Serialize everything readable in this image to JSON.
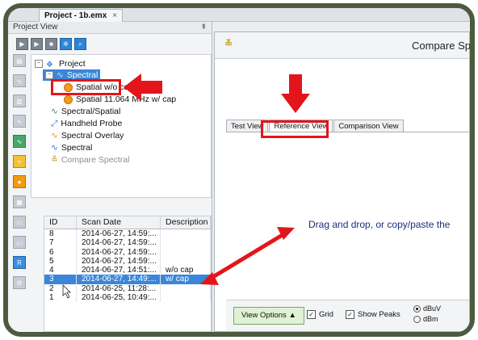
{
  "document_tab": {
    "label": "Project - 1b.emx",
    "close": "×"
  },
  "project_view": {
    "title": "Project View",
    "pin": "⇞"
  },
  "tree": {
    "root": "Project",
    "spectral_selected": "Spectral",
    "child1": "Spatial w/o cap",
    "child2": "Spatial 11.064 MHz w/ cap",
    "item_spectral_spatial": "Spectral/Spatial",
    "item_handheld": "Handheld Probe",
    "item_overlay": "Spectral Overlay",
    "item_spectral": "Spectral",
    "item_compare": "Compare Spectral"
  },
  "scan_table": {
    "headers": [
      "ID",
      "Scan Date",
      "Description"
    ],
    "rows": [
      {
        "id": "8",
        "date": "2014-06-27, 14:59:...",
        "desc": ""
      },
      {
        "id": "7",
        "date": "2014-06-27, 14:59:...",
        "desc": ""
      },
      {
        "id": "6",
        "date": "2014-06-27, 14:59:...",
        "desc": ""
      },
      {
        "id": "5",
        "date": "2014-06-27, 14:59:...",
        "desc": ""
      },
      {
        "id": "4",
        "date": "2014-06-27, 14:51:...",
        "desc": "w/o cap"
      },
      {
        "id": "3",
        "date": "2014-06-27, 14:49:...",
        "desc": "w/ cap"
      },
      {
        "id": "2",
        "date": "2014-06-25, 11:28:...",
        "desc": ""
      },
      {
        "id": "1",
        "date": "2014-06-25, 10:49:...",
        "desc": ""
      }
    ]
  },
  "right_pane": {
    "title": "Compare Spec",
    "tabs": [
      "Test View",
      "Reference View",
      "Comparison View"
    ],
    "drag_message": "Drag and drop, or copy/paste the",
    "view_options": "View Options ▲",
    "grid": "Grid",
    "show_peaks": "Show Peaks",
    "unit1": "dBuV",
    "unit2": "dBm"
  },
  "colors": {
    "accent_red": "#e3151b",
    "selection_blue": "#3b86d8"
  }
}
